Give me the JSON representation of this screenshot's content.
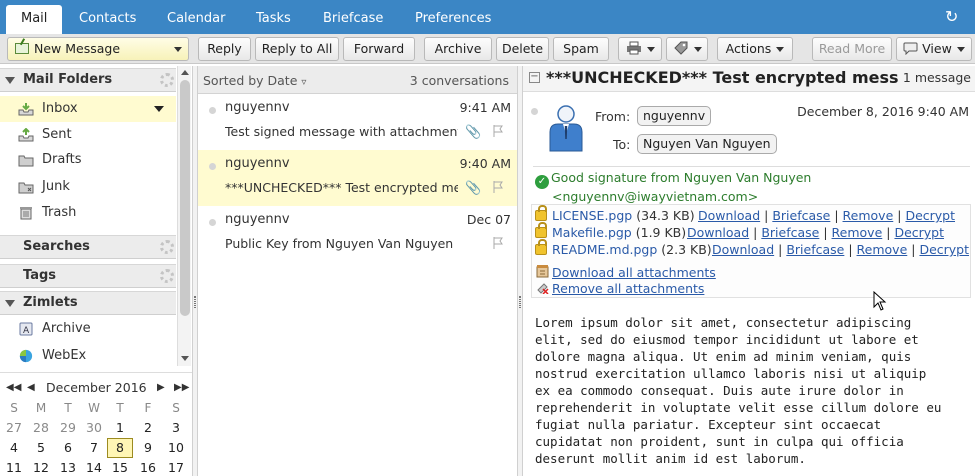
{
  "tabs": [
    {
      "label": "Mail",
      "active": true
    },
    {
      "label": "Contacts"
    },
    {
      "label": "Calendar"
    },
    {
      "label": "Tasks"
    },
    {
      "label": "Briefcase"
    },
    {
      "label": "Preferences"
    }
  ],
  "toolbar": {
    "new_message": "New Message",
    "reply": "Reply",
    "reply_all": "Reply to All",
    "forward": "Forward",
    "archive": "Archive",
    "delete": "Delete",
    "spam": "Spam",
    "actions": "Actions",
    "read_more": "Read More",
    "view": "View"
  },
  "sidebar": {
    "mail_folders": "Mail Folders",
    "folders": [
      {
        "label": "Inbox",
        "icon": "inbox-icon",
        "selected": true
      },
      {
        "label": "Sent",
        "icon": "sent-icon"
      },
      {
        "label": "Drafts",
        "icon": "drafts-icon"
      },
      {
        "label": "Junk",
        "icon": "junk-icon"
      },
      {
        "label": "Trash",
        "icon": "trash-icon"
      }
    ],
    "searches": "Searches",
    "tags": "Tags",
    "zimlets": "Zimlets",
    "zimlet_items": [
      {
        "label": "Archive",
        "icon": "archive-zimlet-icon"
      },
      {
        "label": "WebEx",
        "icon": "webex-icon"
      }
    ]
  },
  "calendar": {
    "title": "December 2016",
    "dow": [
      "S",
      "M",
      "T",
      "W",
      "T",
      "F",
      "S"
    ],
    "weeks": [
      [
        "27",
        "28",
        "29",
        "30",
        "1",
        "2",
        "3"
      ],
      [
        "4",
        "5",
        "6",
        "7",
        "8",
        "9",
        "10"
      ],
      [
        "11",
        "12",
        "13",
        "14",
        "15",
        "16",
        "17"
      ]
    ],
    "today": "8"
  },
  "conversations": {
    "sort_label": "Sorted by Date",
    "count_label": "3 conversations",
    "items": [
      {
        "from": "nguyennv",
        "time": "9:41 AM",
        "subject": "Test signed message with attachment",
        "attachment": true
      },
      {
        "from": "nguyennv",
        "time": "9:40 AM",
        "subject": "***UNCHECKED*** Test encrypted message",
        "attachment": true,
        "selected": true
      },
      {
        "from": "nguyennv",
        "time": "Dec 07",
        "subject": "Public Key from Nguyen Van Nguyen <nguyennv@iwayvietnam.com>",
        "attachment": false
      }
    ]
  },
  "reader": {
    "title": "***UNCHECKED*** Test encrypted message",
    "count": "1 message",
    "from_label": "From:",
    "from_value": "nguyennv",
    "to_label": "To:",
    "to_value": "Nguyen Van Nguyen",
    "date": "December 8, 2016 9:40 AM",
    "signature_line1": "Good signature from Nguyen Van Nguyen",
    "signature_line2": "<nguyennv@iwayvietnam.com>",
    "attachments": [
      {
        "name": "LICENSE.pgp",
        "size": "(34.3 KB)"
      },
      {
        "name": "Makefile.pgp",
        "size": "(1.9 KB)"
      },
      {
        "name": "README.md.pgp",
        "size": "(2.3 KB)"
      }
    ],
    "att_actions": {
      "download": "Download",
      "briefcase": "Briefcase",
      "remove": "Remove",
      "decrypt": "Decrypt",
      "sep": "|"
    },
    "download_all": "Download all attachments",
    "remove_all": "Remove all attachments",
    "body_lines": [
      "Lorem ipsum dolor sit amet, consectetur adipiscing",
      "elit, sed do eiusmod tempor incididunt ut labore et",
      "dolore magna aliqua. Ut enim ad minim veniam, quis",
      "nostrud exercitation ullamco laboris nisi ut aliquip",
      "ex ea commodo consequat. Duis aute irure dolor in",
      "reprehenderit in voluptate velit esse cillum dolore eu",
      "fugiat nulla pariatur. Excepteur sint occaecat",
      "cupidatat non proident, sunt in culpa qui officia",
      "deserunt mollit anim id est laborum."
    ]
  },
  "colors": {
    "tabbar": "#3b86c5",
    "selected": "#fffbd0",
    "link": "#2a5aa8",
    "signature": "#2d7d2d"
  }
}
